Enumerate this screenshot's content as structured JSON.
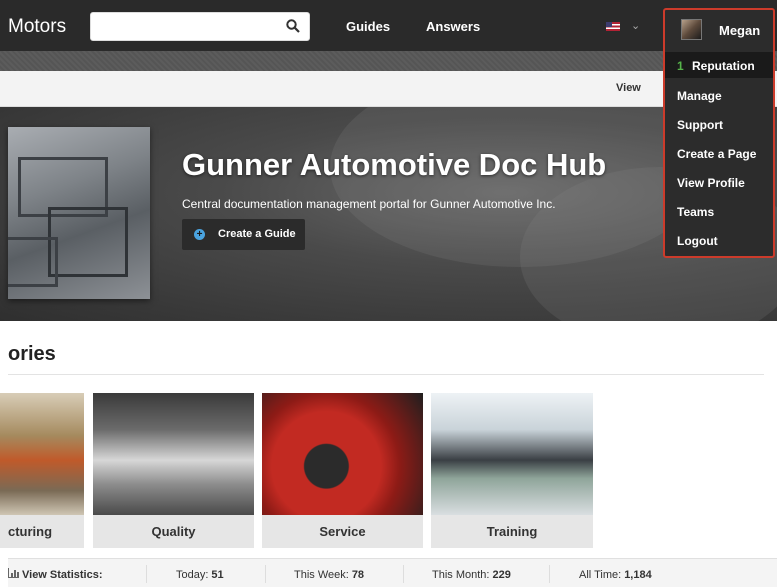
{
  "nav": {
    "brand": "Motors",
    "search_placeholder": "",
    "guides": "Guides",
    "answers": "Answers"
  },
  "subbar": {
    "view": "View"
  },
  "hero": {
    "title": "Gunner Automotive Doc Hub",
    "subtitle": "Central documentation management portal for Gunner Automotive Inc.",
    "create_button": "Create a Guide"
  },
  "categories": {
    "heading": "ories",
    "items": [
      {
        "label": "cturing"
      },
      {
        "label": "Quality"
      },
      {
        "label": "Service"
      },
      {
        "label": "Training"
      }
    ]
  },
  "stats": {
    "label": "View Statistics:",
    "today_label": "Today:",
    "today": "51",
    "week_label": "This Week:",
    "week": "78",
    "month_label": "This Month:",
    "month": "229",
    "all_label": "All Time:",
    "all": "1,184"
  },
  "user_menu": {
    "name": "Megan",
    "reputation_count": "1",
    "reputation_label": "Reputation",
    "items": [
      "Manage",
      "Support",
      "Create a Page",
      "View Profile",
      "Teams",
      "Logout"
    ],
    "highlight_color": "#cc3b2b"
  },
  "icons": [
    "search-icon",
    "flag-icon",
    "chevron-down-icon",
    "plus-icon",
    "chart-icon",
    "avatar"
  ]
}
